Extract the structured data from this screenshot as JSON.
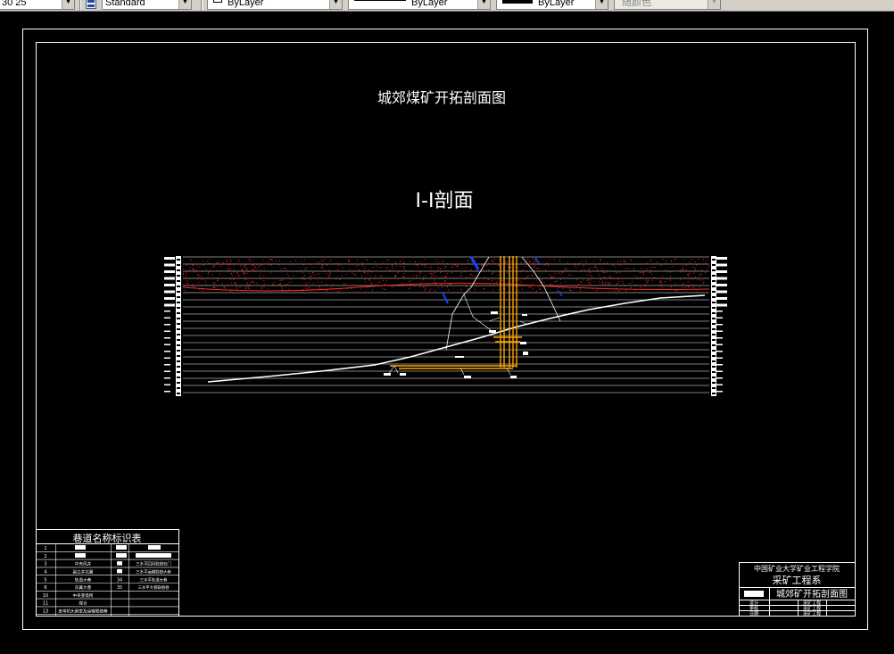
{
  "toolbar": {
    "scale_value": "30 25",
    "text_style_value": "Standard",
    "layer_value": "ByLayer",
    "linetype_value": "ByLayer",
    "lineweight_value": "ByLayer",
    "color_value": "随颜色"
  },
  "drawing": {
    "main_title": "城郊煤矿开拓剖面图",
    "section_title": "I-I剖面",
    "legend_table": {
      "title": "巷道名称标识表",
      "row_numbers": [
        "1",
        "2",
        "3",
        "4",
        "5",
        "6",
        "10",
        "11",
        "13"
      ],
      "left_names": [
        "中央风井",
        "副立井北翼",
        "轨道大巷",
        "东翼大巷",
        "中央变电所",
        "煤仓",
        "皮带机头硐室及运输联络巷"
      ],
      "right_numbers": [
        "34",
        "35"
      ],
      "right_names": [
        "三水平回风联络石门",
        "三水平运输联络大巷",
        "三水平轨道大巷",
        "三水平大巷联络巷"
      ]
    },
    "title_block": {
      "institution": "中国矿业大学矿业工程学院",
      "department": "采矿工程系",
      "drawing_name": "城郊矿开拓剖面图",
      "row_labels": [
        "设计",
        "审核",
        "日期"
      ],
      "right_labels": [
        "采矿工程",
        "采矿工程",
        "采矿工程"
      ]
    },
    "colors": {
      "stratum_dots": "#ff2a1f",
      "shaft": "#ffa500",
      "fault": "#1a3fff",
      "background": "#000000",
      "lines": "#ffffff"
    }
  }
}
